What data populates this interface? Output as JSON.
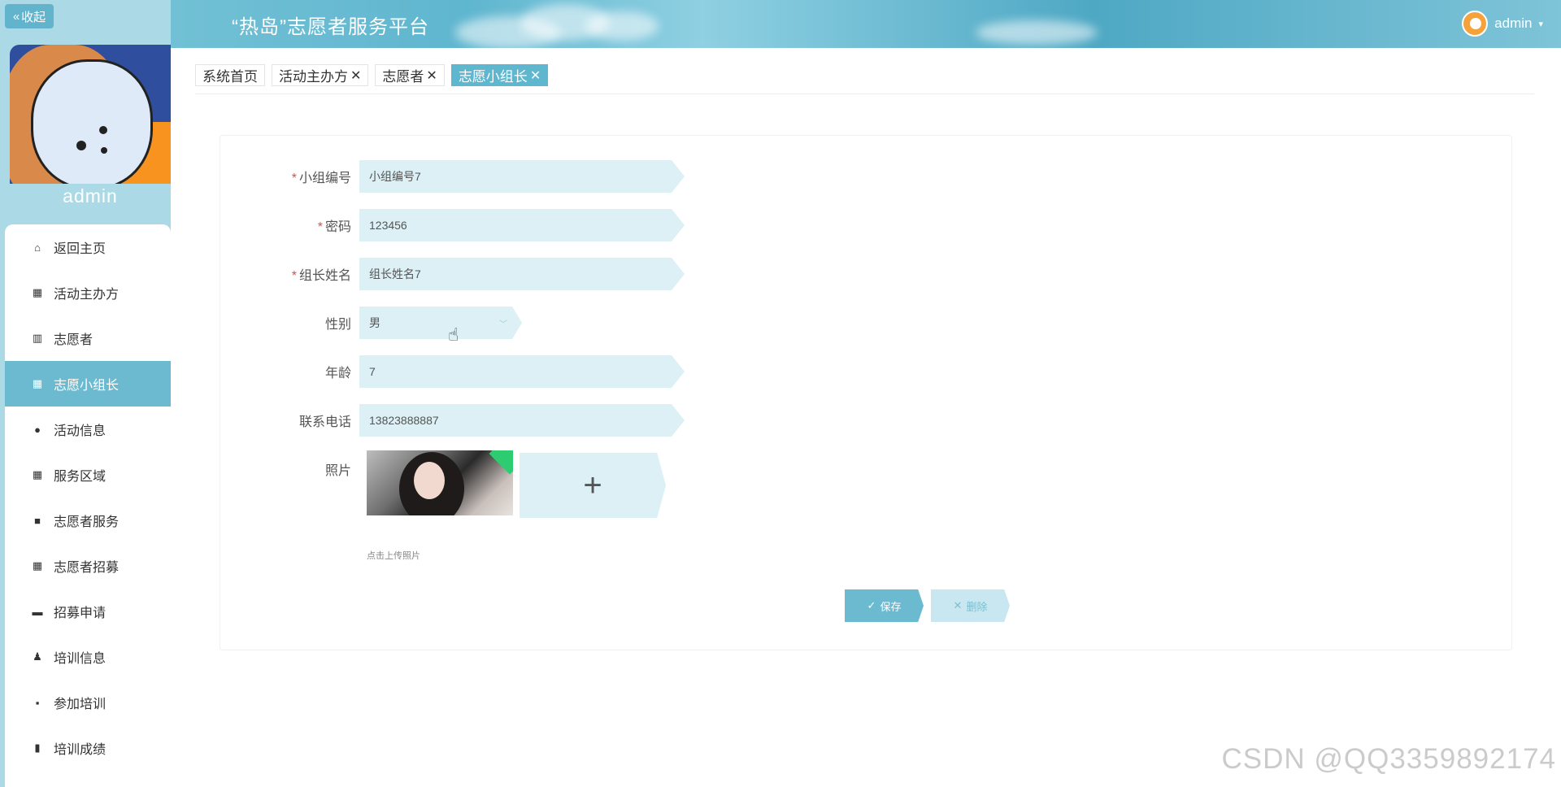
{
  "header": {
    "title": "“热岛”志愿者服务平台",
    "user": "admin"
  },
  "sidebar": {
    "collapse_label": "收起",
    "profile_name": "admin",
    "items": [
      {
        "label": "返回主页",
        "icon": "home-icon"
      },
      {
        "label": "活动主办方",
        "icon": "grid-icon"
      },
      {
        "label": "志愿者",
        "icon": "books-icon"
      },
      {
        "label": "志愿小组长",
        "icon": "grid-icon",
        "active": true
      },
      {
        "label": "活动信息",
        "icon": "bulb-icon"
      },
      {
        "label": "服务区域",
        "icon": "grid-icon"
      },
      {
        "label": "志愿者服务",
        "icon": "video-icon"
      },
      {
        "label": "志愿者招募",
        "icon": "grid-icon"
      },
      {
        "label": "招募申请",
        "icon": "briefcase-icon"
      },
      {
        "label": "培训信息",
        "icon": "user-icon"
      },
      {
        "label": "参加培训",
        "icon": "comment-icon"
      },
      {
        "label": "培训成绩",
        "icon": "clipboard-icon"
      }
    ]
  },
  "tabs": [
    {
      "label": "系统首页",
      "closable": false
    },
    {
      "label": "活动主办方",
      "closable": true
    },
    {
      "label": "志愿者",
      "closable": true
    },
    {
      "label": "志愿小组长",
      "closable": true,
      "active": true
    }
  ],
  "form": {
    "group_no": {
      "label": "小组编号",
      "value": "小组编号7",
      "required": true
    },
    "password": {
      "label": "密码",
      "value": "123456",
      "required": true
    },
    "leader_name": {
      "label": "组长姓名",
      "value": "组长姓名7",
      "required": true
    },
    "gender": {
      "label": "性别",
      "value": "男"
    },
    "age": {
      "label": "年龄",
      "value": "7"
    },
    "phone": {
      "label": "联系电话",
      "value": "13823888887"
    },
    "photo": {
      "label": "照片",
      "tip": "点击上传照片"
    },
    "save_label": "保存",
    "delete_label": "删除"
  },
  "watermark": "CSDN @QQ3359892174",
  "colors": {
    "accent": "#6bbad0",
    "input_bg": "#dcf0f6",
    "required": "#e74c3c"
  }
}
